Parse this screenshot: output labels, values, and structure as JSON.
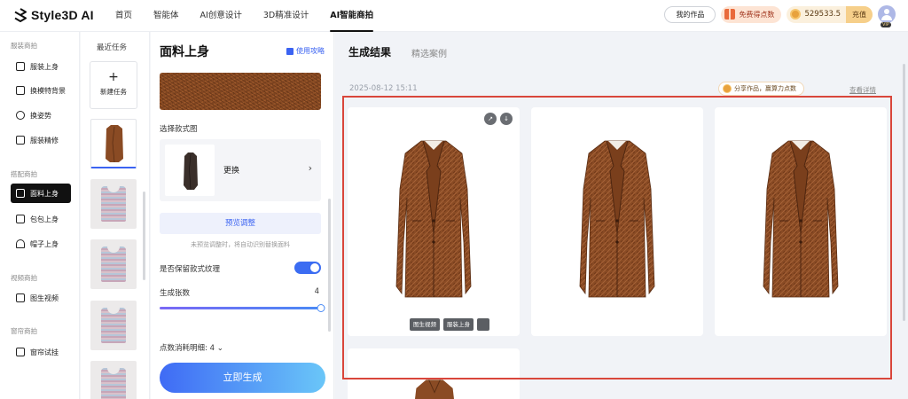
{
  "topbar": {
    "brand": "Style3D AI",
    "nav": [
      "首页",
      "智能体",
      "AI创意设计",
      "3D精准设计",
      "AI智能商拍"
    ],
    "active_nav": 4,
    "my_works": "我的作品",
    "free_points": "免费得点数",
    "balance": "529533.5",
    "recharge": "充值",
    "vip": "VIP"
  },
  "sidebar": {
    "groups": [
      {
        "title": "服装商拍",
        "items": [
          {
            "label": "服装上身",
            "icon": "tshirt-icon"
          },
          {
            "label": "换模特背景",
            "icon": "swap-icon"
          },
          {
            "label": "换姿势",
            "icon": "pose-icon"
          },
          {
            "label": "服装精修",
            "icon": "retouch-icon"
          }
        ]
      },
      {
        "title": "搭配商拍",
        "items": [
          {
            "label": "面料上身",
            "icon": "fabric-icon",
            "active": true
          },
          {
            "label": "包包上身",
            "icon": "bag-icon"
          },
          {
            "label": "帽子上身",
            "icon": "hat-icon"
          }
        ]
      },
      {
        "title": "视频商拍",
        "items": [
          {
            "label": "图生视频",
            "icon": "video-icon"
          }
        ]
      },
      {
        "title": "窗帘商拍",
        "items": [
          {
            "label": "窗帘试挂",
            "icon": "curtain-icon"
          }
        ]
      }
    ]
  },
  "recent": {
    "title": "最近任务",
    "new_task": "新建任务"
  },
  "panel": {
    "title": "面料上身",
    "guide": "使用攻略",
    "select_style_label": "选择款式图",
    "replace": "更换",
    "preview_button": "预览调整",
    "preview_hint": "未预览调整时，将自动识别替换面料",
    "keep_texture_label": "是否保留款式纹理",
    "keep_texture_on": true,
    "count_label": "生成张数",
    "count_value": "4",
    "count_fraction": 1.0,
    "points_detail": "点数消耗明细: 4",
    "generate_button": "立即生成"
  },
  "main": {
    "tab_results": "生成结果",
    "tab_examples": "精选案例",
    "date": "2025-08-12 15:11",
    "share": "分享作品，赢算力点数",
    "details": "查看详情",
    "card_actions": [
      "图生视频",
      "服装上身"
    ]
  },
  "colors": {
    "accent": "#3b63f2",
    "highlight": "#d9463b",
    "coat": "#8a4b24"
  }
}
